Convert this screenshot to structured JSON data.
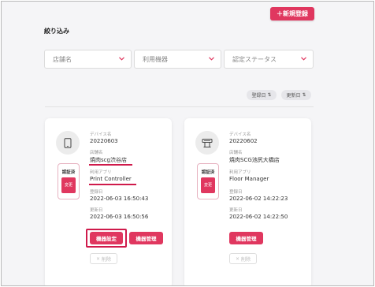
{
  "header": {
    "new_button_label": "＋新規登録",
    "filter_title": "絞り込み"
  },
  "filters": [
    {
      "placeholder": "店舗名"
    },
    {
      "placeholder": "利用機器"
    },
    {
      "placeholder": "認定ステータス"
    }
  ],
  "sort": {
    "registered": "登録日",
    "updated": "更新日"
  },
  "cards": [
    {
      "device_icon": "tablet-icon",
      "cert_label": "認証済",
      "cert_change": "変更",
      "device_name_label": "デバイス名",
      "device_name": "20220603",
      "store_label": "店舗名",
      "store": "焼肉scg渋谷店",
      "app_label": "利用アプリ",
      "app": "Print Controller",
      "registered_label": "登録日",
      "registered": "2022-06-03 16:50:43",
      "updated_label": "更新日",
      "updated": "2022-06-03 16:50:56",
      "btn_settings": "機器設定",
      "btn_manage": "機器管理",
      "btn_delete": "削除"
    },
    {
      "device_icon": "printer-icon",
      "cert_label": "認証済",
      "cert_change": "変更",
      "device_name_label": "デバイス名",
      "device_name": "20220602",
      "store_label": "店舗名",
      "store": "焼肉SCG池尻大橋店",
      "app_label": "利用アプリ",
      "app": "Floor Manager",
      "registered_label": "登録日",
      "registered": "2022-06-02 14:22:23",
      "updated_label": "更新日",
      "updated": "2022-06-02 14:22:50",
      "btn_manage": "機器管理",
      "btn_delete": "削除"
    }
  ],
  "colors": {
    "accent": "#e0375f",
    "highlight": "#cf1a4b"
  }
}
